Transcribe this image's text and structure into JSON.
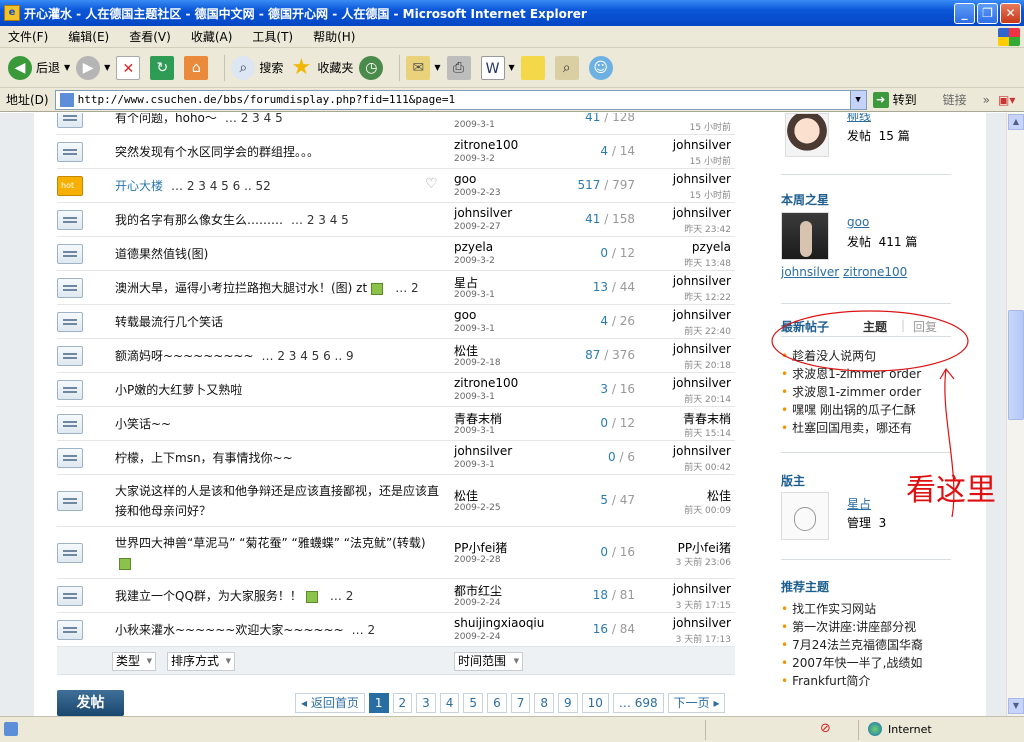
{
  "window": {
    "title": "开心灌水 - 人在德国主题社区 - 德国中文网 - 德国开心网 - 人在德国 - Microsoft Internet Explorer",
    "btns": [
      "_",
      "❐",
      "✕"
    ]
  },
  "menu": [
    "文件(F)",
    "编辑(E)",
    "查看(V)",
    "收藏(A)",
    "工具(T)",
    "帮助(H)"
  ],
  "toolbar": {
    "back": "后退",
    "search": "搜索",
    "favorites": "收藏夹"
  },
  "address": {
    "label": "地址(D)",
    "url": "http://www.csuchen.de/bbs/forumdisplay.php?fid=111&page=1",
    "go": "转到",
    "links": "链接"
  },
  "threads": [
    {
      "title": "有个问题，hoho～",
      "pages": "… 2 3 4 5",
      "author": "",
      "adate": "2009-3-1",
      "replies": "41",
      "views": "128",
      "last": "",
      "ldate": "15 小时前",
      "hot": false
    },
    {
      "title": "突然发现有个水区同学会的群组捏。。。",
      "pages": "",
      "author": "zitrone100",
      "adate": "2009-3-2",
      "replies": "4",
      "views": "14",
      "last": "johnsilver",
      "ldate": "15 小时前",
      "hot": false
    },
    {
      "title": "开心大楼",
      "pages": "… 2 3 4 5 6 .. 52",
      "author": "goo",
      "adate": "2009-2-23",
      "replies": "517",
      "views": "797",
      "last": "johnsilver",
      "ldate": "15 小时前",
      "hot": true
    },
    {
      "title": "我的名字有那么像女生么………",
      "pages": "… 2 3 4 5",
      "author": "johnsilver",
      "adate": "2009-2-27",
      "replies": "41",
      "views": "158",
      "last": "johnsilver",
      "ldate": "昨天 23:42",
      "hot": false
    },
    {
      "title": "道德果然值钱(图)",
      "pages": "",
      "author": "pzyela",
      "adate": "2009-3-2",
      "replies": "0",
      "views": "12",
      "last": "pzyela",
      "ldate": "昨天 13:48",
      "hot": false
    },
    {
      "title": "澳洲大旱，逼得小考拉拦路抱大腿讨水！(图) zt",
      "pages": "… 2",
      "author": "星占",
      "adate": "2009-3-1",
      "replies": "13",
      "views": "44",
      "last": "johnsilver",
      "ldate": "昨天 12:22",
      "hot": false,
      "img": true
    },
    {
      "title": "转载最流行几个笑话",
      "pages": "",
      "author": "goo",
      "adate": "2009-3-1",
      "replies": "4",
      "views": "26",
      "last": "johnsilver",
      "ldate": "前天 22:40",
      "hot": false
    },
    {
      "title": "额滴妈呀~~~~~~~~~",
      "pages": "… 2 3 4 5 6 .. 9",
      "author": "松佳",
      "adate": "2009-2-18",
      "replies": "87",
      "views": "376",
      "last": "johnsilver",
      "ldate": "前天 20:18",
      "hot": false
    },
    {
      "title": "小P嫩的大红萝卜又熟啦",
      "pages": "",
      "author": "zitrone100",
      "adate": "2009-3-1",
      "replies": "3",
      "views": "16",
      "last": "johnsilver",
      "ldate": "前天 20:14",
      "hot": false
    },
    {
      "title": "小笑话~~",
      "pages": "",
      "author": "青春末梢",
      "adate": "2009-3-1",
      "replies": "0",
      "views": "12",
      "last": "青春末梢",
      "ldate": "前天 15:14",
      "hot": false
    },
    {
      "title": "柠檬，上下msn，有事情找你~~",
      "pages": "",
      "author": "johnsilver",
      "adate": "2009-3-1",
      "replies": "0",
      "views": "6",
      "last": "johnsilver",
      "ldate": "前天 00:42",
      "hot": false
    },
    {
      "title": "大家说这样的人是该和他争辩还是应该直接鄙视，还是应该直接和他母亲问好？",
      "pages": "",
      "author": "松佳",
      "adate": "2009-2-25",
      "replies": "5",
      "views": "47",
      "last": "松佳",
      "ldate": "前天 00:09",
      "hot": false,
      "tall": true
    },
    {
      "title": "世界四大神兽“草泥马” “菊花蚕” “雅蠛蝶” “法克鱿”(转载)",
      "pages": "",
      "author": "PP小fei猪",
      "adate": "2009-2-28",
      "replies": "0",
      "views": "16",
      "last": "PP小fei猪",
      "ldate": "3 天前 23:06",
      "hot": false,
      "tall": true,
      "img": true
    },
    {
      "title": "我建立一个QQ群，为大家服务！！",
      "pages": "… 2",
      "author": "都市红尘",
      "adate": "2009-2-24",
      "replies": "18",
      "views": "81",
      "last": "johnsilver",
      "ldate": "3 天前 17:15",
      "hot": false,
      "img": true
    },
    {
      "title": "小秋来灌水~~~~~~欢迎大家~~~~~~",
      "pages": "… 2",
      "author": "shuijingxiaoqiu",
      "adate": "2009-2-24",
      "replies": "16",
      "views": "84",
      "last": "johnsilver",
      "ldate": "3 天前 17:13",
      "hot": false
    }
  ],
  "filters": {
    "type": "类型",
    "sort": "排序方式",
    "time": "时间范围"
  },
  "post_btn": "发帖",
  "pager": {
    "first": "返回首页",
    "pages": [
      "1",
      "2",
      "3",
      "4",
      "5",
      "6",
      "7",
      "8",
      "9",
      "10",
      "… 698"
    ],
    "next": "下一页"
  },
  "sidebar": {
    "top_user": {
      "name": "柳线",
      "posts_label": "发帖",
      "posts": "15 篇"
    },
    "week_star": {
      "heading": "本周之星",
      "name": "goo",
      "posts_label": "发帖",
      "posts": "411 篇",
      "others": [
        "johnsilver",
        "zitrone100"
      ]
    },
    "latest": {
      "heading": "最新帖子",
      "tab_topic": "主题",
      "tab_reply": "回复",
      "items": [
        "趁着没人说两句",
        "求波恩1-zimmer order",
        "求波恩1-zimmer order",
        "嘿嘿 刚出锅的瓜子仁酥",
        "杜塞回国甩卖，哪还有"
      ]
    },
    "mod": {
      "heading": "版主",
      "name": "星占",
      "manage_label": "管理",
      "manage": "3"
    },
    "recommend": {
      "heading": "推荐主题",
      "items": [
        "找工作实习网站",
        "第一次讲座:讲座部分视",
        "7月24法兰克福德国华裔",
        "2007年快一半了,战绩如",
        "Frankfurt简介"
      ]
    }
  },
  "annotation": "看这里",
  "status": {
    "zone": "Internet"
  },
  "colors": {
    "accent": "#2a6da3",
    "annot": "#d11"
  }
}
